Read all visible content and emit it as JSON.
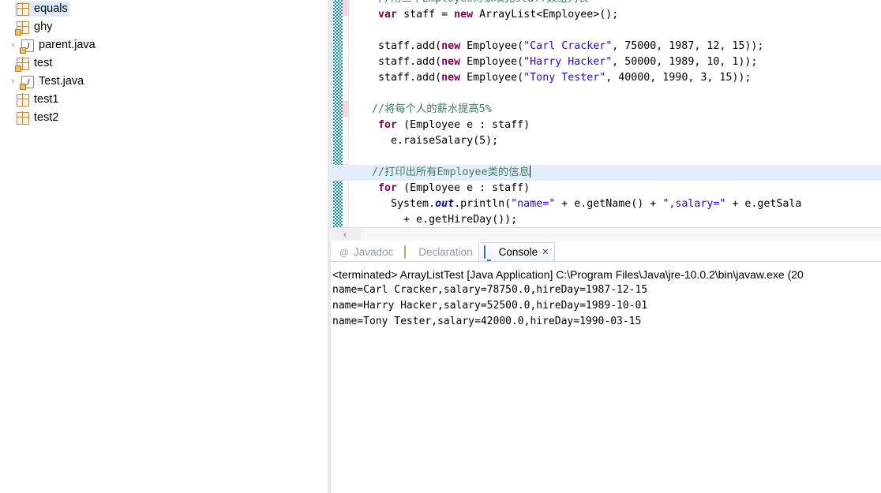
{
  "explorer": {
    "name": "package-explorer",
    "rows": [
      {
        "label": "equals",
        "icon": "package-icon",
        "twisty": "",
        "indent": 0,
        "selected": true,
        "decorated": false
      },
      {
        "label": "ghy",
        "icon": "package-icon",
        "twisty": "",
        "indent": 0,
        "selected": false,
        "decorated": true
      },
      {
        "label": "parent.java",
        "icon": "java-file-icon",
        "twisty": "›",
        "indent": 1,
        "selected": false,
        "decorated": true
      },
      {
        "label": "test",
        "icon": "package-icon",
        "twisty": "",
        "indent": 0,
        "selected": false,
        "decorated": true
      },
      {
        "label": "Test.java",
        "icon": "java-file-icon",
        "twisty": "›",
        "indent": 1,
        "selected": false,
        "decorated": true
      },
      {
        "label": "test1",
        "icon": "package-icon",
        "twisty": "",
        "indent": 0,
        "selected": false,
        "decorated": false
      },
      {
        "label": "test2",
        "icon": "package-icon",
        "twisty": "",
        "indent": 0,
        "selected": false,
        "decorated": false
      }
    ]
  },
  "editor": {
    "name": "java-source-editor",
    "current_line_index": 9,
    "caret_after_text": "//打印出所有Employee类的信息",
    "lines": [
      {
        "text": "//用三个Employee对象填充staff数组列表",
        "indent": 4,
        "kind": "comment",
        "clipped_top": true
      },
      {
        "text": "var staff = new ArrayList<Employee>();",
        "indent": 4,
        "kind": "code"
      },
      {
        "text": "",
        "indent": 0,
        "kind": "blank"
      },
      {
        "text": "staff.add(new Employee(\"Carl Cracker\", 75000, 1987, 12, 15));",
        "indent": 4,
        "kind": "code"
      },
      {
        "text": "staff.add(new Employee(\"Harry Hacker\", 50000, 1989, 10, 1));",
        "indent": 4,
        "kind": "code"
      },
      {
        "text": "staff.add(new Employee(\"Tony Tester\", 40000, 1990, 3, 15));",
        "indent": 4,
        "kind": "code"
      },
      {
        "text": "",
        "indent": 0,
        "kind": "blank"
      },
      {
        "text": "//将每个人的薪水提高5%",
        "indent": 3,
        "kind": "comment"
      },
      {
        "text": "for (Employee e : staff)",
        "indent": 4,
        "kind": "code"
      },
      {
        "text": "e.raiseSalary(5);",
        "indent": 6,
        "kind": "code"
      },
      {
        "text": "",
        "indent": 0,
        "kind": "blank"
      },
      {
        "text": "//打印出所有Employee类的信息",
        "indent": 3,
        "kind": "comment",
        "current": true
      },
      {
        "text": "for (Employee e : staff)",
        "indent": 4,
        "kind": "code"
      },
      {
        "text": "System.out.println(\"name=\" + e.getName() + \",salary=\" + e.getSala",
        "indent": 6,
        "kind": "code",
        "clipped_right": true
      },
      {
        "text": "+ e.getHireDay());",
        "indent": 8,
        "kind": "code"
      }
    ],
    "scrollbar": {
      "left_arrow": "‹"
    }
  },
  "bottom_view": {
    "name": "console-view",
    "tabs": [
      {
        "label": "Javadoc",
        "icon": "at-icon",
        "active": false,
        "closable": false
      },
      {
        "label": "Declaration",
        "icon": "declaration-icon",
        "active": false,
        "closable": false
      },
      {
        "label": "Console",
        "icon": "console-icon",
        "active": true,
        "closable": true,
        "close_glyph": "✕"
      }
    ],
    "terminated_line": "<terminated> ArrayListTest [Java Application] C:\\Program Files\\Java\\jre-10.0.2\\bin\\javaw.exe (20",
    "output_lines": [
      "name=Carl Cracker,salary=78750.0,hireDay=1987-12-15",
      "name=Harry Hacker,salary=52500.0,hireDay=1989-10-01",
      "name=Tony Tester,salary=42000.0,hireDay=1990-03-15"
    ]
  },
  "colors": {
    "selection": "#dceaf7",
    "current_line": "#e4eefb",
    "change_bar": "#119aad",
    "marker_pink": "#f7d5e2",
    "comment": "#3f7f5f",
    "keyword": "#7f0055",
    "string": "#2a00ff",
    "field": "#0000c0",
    "package_icon": "#c98b3f"
  }
}
